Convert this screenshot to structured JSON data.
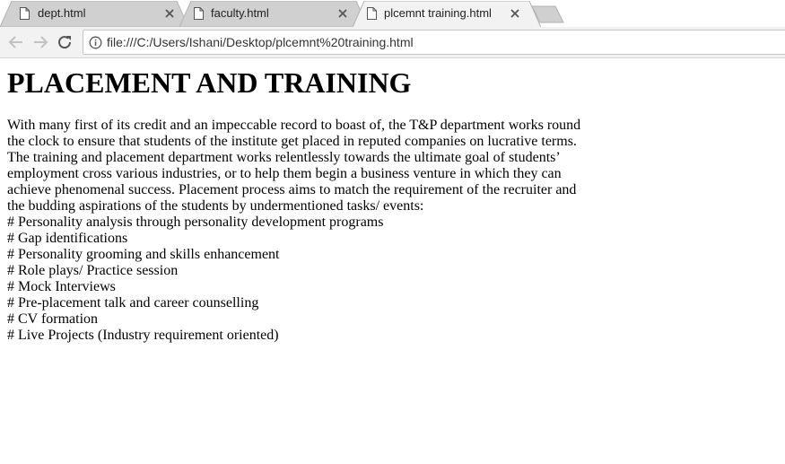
{
  "browser": {
    "tabs": [
      {
        "title": "dept.html",
        "active": false
      },
      {
        "title": "faculty.html",
        "active": false
      },
      {
        "title": "plcemnt training.html",
        "active": true
      }
    ],
    "address_bar": {
      "url": "file:///C:/Users/Ishani/Desktop/plcemnt%20training.html"
    }
  },
  "page": {
    "heading": "PLACEMENT AND TRAINING",
    "paragraph_lines": [
      "With many first of its credit and an impeccable record to boast of, the T&P department works round",
      "the clock to ensure that students of the institute get placed in reputed companies on lucrative terms.",
      "The training and placement department works relentlessly towards the ultimate goal of students’",
      "employment cross various industries, or to help them begin a business venture in which they can",
      "achieve phenomenal success. Placement process aims to match the requirement of the recruiter and",
      "the budding aspirations of the students by undermentioned tasks/ events:"
    ],
    "list_items": [
      "# Personality analysis through personality development programs",
      "# Gap identifications",
      "# Personality grooming and skills enhancement",
      "# Role plays/ Practice session",
      "# Mock Interviews",
      "# Pre-placement talk and career counselling",
      "# CV formation",
      "# Live Projects (Industry requirement oriented)"
    ]
  },
  "colors": {
    "inactive_tab": "#d0d0d0",
    "active_tab": "#f2f2f2",
    "toolbar": "#f2f2f2",
    "text": "#000000"
  }
}
